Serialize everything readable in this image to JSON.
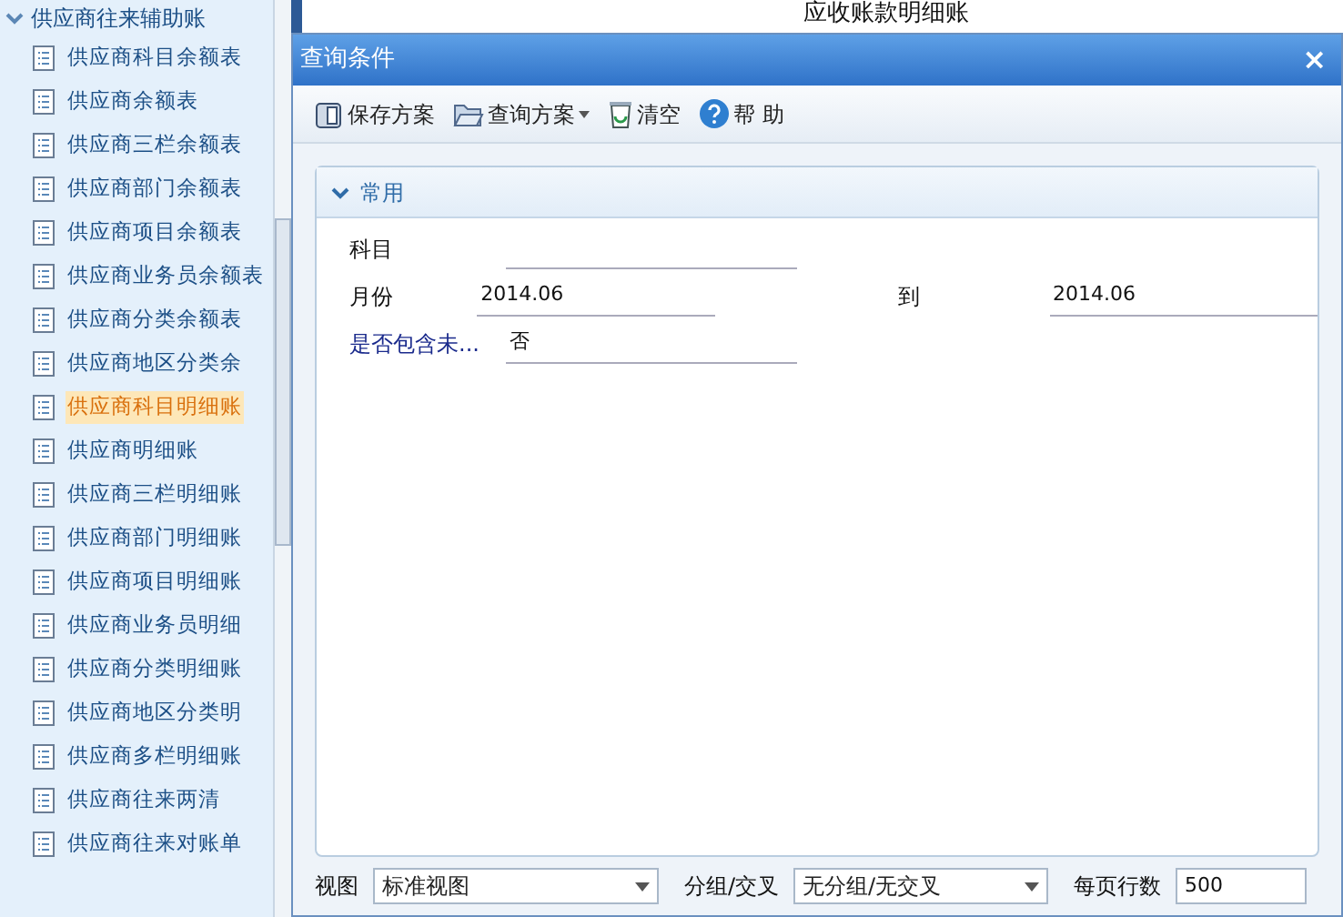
{
  "sidebar": {
    "group": {
      "label": "供应商往来辅助账",
      "expanded": true
    },
    "items": [
      {
        "label": "供应商科目余额表",
        "selected": false
      },
      {
        "label": "供应商余额表",
        "selected": false
      },
      {
        "label": "供应商三栏余额表",
        "selected": false
      },
      {
        "label": "供应商部门余额表",
        "selected": false
      },
      {
        "label": "供应商项目余额表",
        "selected": false
      },
      {
        "label": "供应商业务员余额表",
        "selected": false
      },
      {
        "label": "供应商分类余额表",
        "selected": false
      },
      {
        "label": "供应商地区分类余",
        "selected": false
      },
      {
        "label": "供应商科目明细账",
        "selected": true
      },
      {
        "label": "供应商明细账",
        "selected": false
      },
      {
        "label": "供应商三栏明细账",
        "selected": false
      },
      {
        "label": "供应商部门明细账",
        "selected": false
      },
      {
        "label": "供应商项目明细账",
        "selected": false
      },
      {
        "label": "供应商业务员明细",
        "selected": false
      },
      {
        "label": "供应商分类明细账",
        "selected": false
      },
      {
        "label": "供应商地区分类明",
        "selected": false
      },
      {
        "label": "供应商多栏明细账",
        "selected": false
      },
      {
        "label": "供应商往来两清",
        "selected": false
      },
      {
        "label": "供应商往来对账单",
        "selected": false
      }
    ]
  },
  "report_title": "应收账款明细账",
  "dialog": {
    "title": "查询条件",
    "close": "×",
    "toolbar": [
      {
        "kind": "save",
        "label": "保存方案"
      },
      {
        "kind": "menu",
        "label": "查询方案"
      },
      {
        "kind": "clear",
        "label": "清空"
      },
      {
        "kind": "help",
        "label": "帮 助"
      }
    ],
    "section": {
      "title": "常用",
      "expanded": true
    },
    "fields": [
      {
        "label": "科目",
        "highlight": false
      },
      {
        "label": "月份",
        "value": "2014.06",
        "to_label": "到",
        "to_value": "2014.06",
        "highlight": false
      },
      {
        "label": "是否包含未...",
        "value": "否",
        "highlight": true
      }
    ],
    "footer": {
      "view_label": "视图",
      "view_value": "标准视图",
      "group_label": "分组/交叉",
      "group_value": "无分组/无交叉",
      "rows_label": "每页行数",
      "rows_value": "500"
    }
  }
}
